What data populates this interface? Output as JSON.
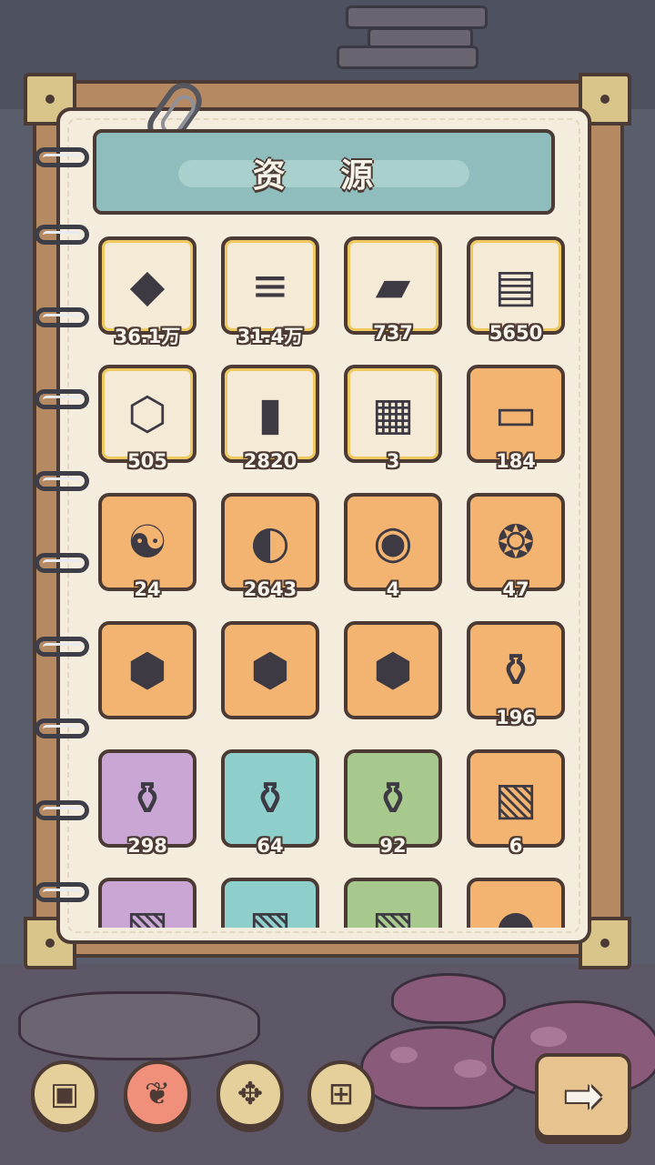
{
  "title": "资 源",
  "colors": {
    "tile_cream": "#f4ead6",
    "tile_orange": "#f3b472",
    "tile_purple": "#c9a6d4",
    "tile_teal": "#8ecfcb",
    "tile_green": "#a8c98d",
    "frame": "#b58a62",
    "outline": "#4b3b34"
  },
  "items": [
    {
      "icon": "stone-pile-icon",
      "glyph": "◆",
      "bg": "cream",
      "count": "36.1万"
    },
    {
      "icon": "log-bundle-icon",
      "glyph": "≡",
      "bg": "cream",
      "count": "31.4万"
    },
    {
      "icon": "paint-tube-icon",
      "glyph": "▰",
      "bg": "cream",
      "count": "737"
    },
    {
      "icon": "paper-scrap-icon",
      "glyph": "▤",
      "bg": "cream",
      "count": "5650"
    },
    {
      "icon": "perfume-bottle-icon",
      "glyph": "⬡",
      "bg": "cream",
      "count": "505"
    },
    {
      "icon": "scroll-tube-icon",
      "glyph": "▮",
      "bg": "cream",
      "count": "2820"
    },
    {
      "icon": "film-strip-icon",
      "glyph": "▦",
      "bg": "cream",
      "count": "3"
    },
    {
      "icon": "ticket-icon",
      "glyph": "▭",
      "bg": "orange",
      "count": "184"
    },
    {
      "icon": "yin-yang-coin-icon",
      "glyph": "☯",
      "bg": "orange",
      "count": "24"
    },
    {
      "icon": "koi-fish-icon",
      "glyph": "◐",
      "bg": "orange",
      "count": "2643"
    },
    {
      "icon": "glass-orb-icon",
      "glyph": "◉",
      "bg": "orange",
      "count": "4"
    },
    {
      "icon": "bubble-orbs-icon",
      "glyph": "❂",
      "bg": "orange",
      "count": "47"
    },
    {
      "icon": "green-hex-gem-icon",
      "glyph": "⬢",
      "bg": "orange",
      "count": ""
    },
    {
      "icon": "blue-hex-gem-icon",
      "glyph": "⬢",
      "bg": "orange",
      "count": ""
    },
    {
      "icon": "purple-hex-gem-icon",
      "glyph": "⬢",
      "bg": "orange",
      "count": ""
    },
    {
      "icon": "amber-potion-icon",
      "glyph": "⚱",
      "bg": "orange",
      "count": "196"
    },
    {
      "icon": "purple-potion-icon",
      "glyph": "⚱",
      "bg": "purple",
      "count": "298"
    },
    {
      "icon": "blue-potion-icon",
      "glyph": "⚱",
      "bg": "teal",
      "count": "64"
    },
    {
      "icon": "green-potion-icon",
      "glyph": "⚱",
      "bg": "green",
      "count": "92"
    },
    {
      "icon": "portrait-cards-icon",
      "glyph": "▧",
      "bg": "orange",
      "count": "6"
    },
    {
      "icon": "purple-portrait-cards-icon",
      "glyph": "▧",
      "bg": "purple",
      "count": ""
    },
    {
      "icon": "teal-portrait-cards-icon",
      "glyph": "▧",
      "bg": "teal",
      "count": ""
    },
    {
      "icon": "green-portrait-cards-icon",
      "glyph": "▧",
      "bg": "green",
      "count": ""
    },
    {
      "icon": "honey-jar-icon",
      "glyph": "◓",
      "bg": "orange",
      "count": ""
    }
  ],
  "bottom_nav": [
    {
      "icon": "briefcase-icon",
      "glyph": "▣",
      "active": false
    },
    {
      "icon": "branch-icon",
      "glyph": "❦",
      "active": true
    },
    {
      "icon": "puzzle-piece-icon",
      "glyph": "✥",
      "active": false
    },
    {
      "icon": "treasure-chest-icon",
      "glyph": "⊞",
      "active": false
    }
  ],
  "next_button": {
    "icon": "arrow-right-icon",
    "glyph": "➡"
  }
}
